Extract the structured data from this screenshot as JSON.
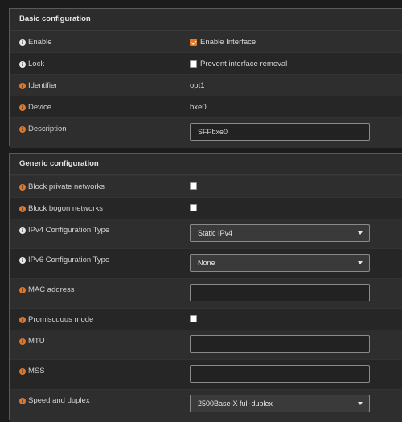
{
  "basic": {
    "header": "Basic configuration",
    "enable": {
      "label": "Enable",
      "checkbox_label": "Enable Interface",
      "checked": true
    },
    "lock": {
      "label": "Lock",
      "checkbox_label": "Prevent interface removal",
      "checked": false
    },
    "identifier": {
      "label": "Identifier",
      "value": "opt1"
    },
    "device": {
      "label": "Device",
      "value": "bxe0"
    },
    "description": {
      "label": "Description",
      "value": "SFPbxe0"
    }
  },
  "generic": {
    "header": "Generic configuration",
    "block_private": {
      "label": "Block private networks",
      "checked": false
    },
    "block_bogon": {
      "label": "Block bogon networks",
      "checked": false
    },
    "ipv4_type": {
      "label": "IPv4 Configuration Type",
      "value": "Static IPv4"
    },
    "ipv6_type": {
      "label": "IPv6 Configuration Type",
      "value": "None"
    },
    "mac": {
      "label": "MAC address",
      "value": ""
    },
    "promiscuous": {
      "label": "Promiscuous mode",
      "checked": false
    },
    "mtu": {
      "label": "MTU",
      "value": ""
    },
    "mss": {
      "label": "MSS",
      "value": ""
    },
    "speed": {
      "label": "Speed and duplex",
      "value": "2500Base-X full-duplex"
    }
  },
  "colors": {
    "accent": "#e0782a",
    "background": "#1c1c1c",
    "panel": "#262626"
  },
  "icons": {
    "info_white": "info-icon",
    "info_orange": "info-icon"
  }
}
